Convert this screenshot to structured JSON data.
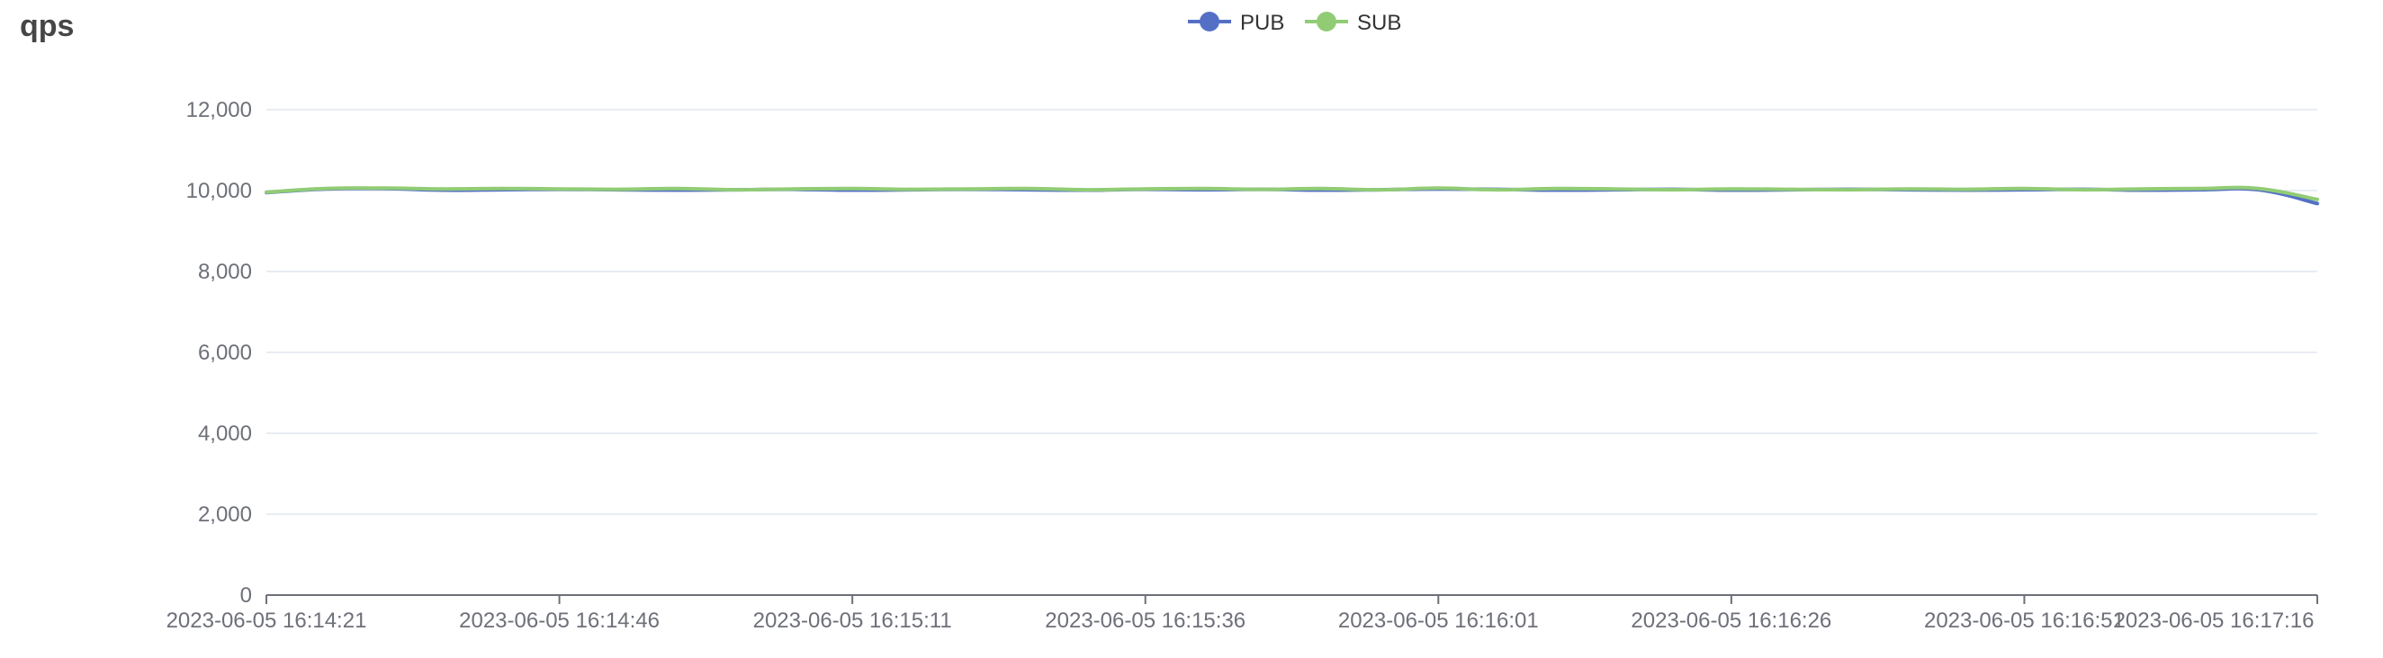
{
  "chart_data": {
    "type": "line",
    "title": "qps",
    "xlabel": "",
    "ylabel": "",
    "ylim": [
      0,
      12000
    ],
    "yticks": [
      0,
      2000,
      4000,
      6000,
      8000,
      10000,
      12000
    ],
    "ytick_labels": [
      "0",
      "2,000",
      "4,000",
      "6,000",
      "8,000",
      "10,000",
      "12,000"
    ],
    "x_tick_labels": [
      "2023-06-05 16:14:21",
      "2023-06-05 16:14:46",
      "2023-06-05 16:15:11",
      "2023-06-05 16:15:36",
      "2023-06-05 16:16:01",
      "2023-06-05 16:16:26",
      "2023-06-05 16:16:51",
      "2023-06-05 16:17:16"
    ],
    "x_range": [
      "2023-06-05 16:14:21",
      "2023-06-05 16:17:16"
    ],
    "x_step_seconds": 5,
    "grid": true,
    "legend_position": "top-center",
    "series": [
      {
        "name": "PUB",
        "color": "#5470c6",
        "values": [
          9950,
          10040,
          10050,
          10010,
          10020,
          10030,
          10020,
          10010,
          10020,
          10030,
          10010,
          10020,
          10030,
          10020,
          10010,
          10030,
          10020,
          10030,
          10010,
          10020,
          10040,
          10030,
          10010,
          10020,
          10030,
          10010,
          10020,
          10030,
          10020,
          10010,
          10020,
          10030,
          10010,
          10020,
          10020,
          9680
        ]
      },
      {
        "name": "SUB",
        "color": "#91cc75",
        "values": [
          9960,
          10050,
          10060,
          10040,
          10050,
          10040,
          10030,
          10050,
          10020,
          10040,
          10050,
          10030,
          10040,
          10050,
          10020,
          10040,
          10050,
          10030,
          10050,
          10020,
          10060,
          10020,
          10050,
          10040,
          10020,
          10040,
          10030,
          10020,
          10040,
          10030,
          10050,
          10020,
          10040,
          10050,
          10050,
          9780
        ]
      }
    ]
  }
}
